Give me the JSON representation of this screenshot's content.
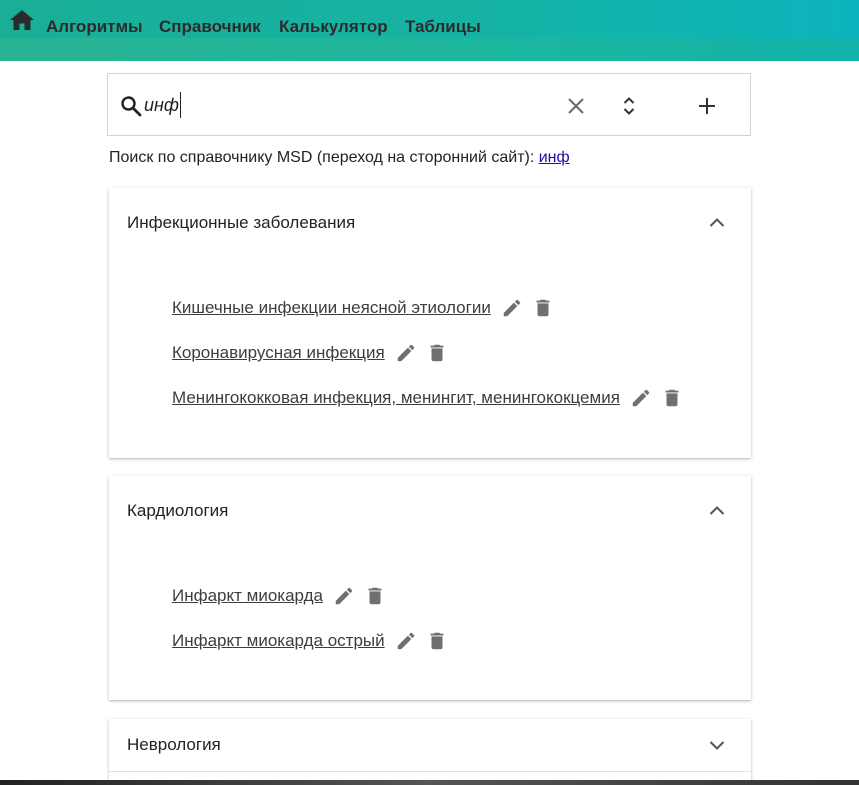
{
  "nav": {
    "home_icon": "home-icon",
    "items": [
      "Алгоритмы",
      "Справочник",
      "Калькулятор",
      "Таблицы"
    ]
  },
  "search": {
    "value": "инф",
    "icons": [
      "search-icon",
      "clear-icon",
      "expand-collapse-icon",
      "add-icon"
    ]
  },
  "msd": {
    "prefix": "Поиск по справочнику MSD (переход на сторонний сайт): ",
    "link": "инф"
  },
  "sections": [
    {
      "title": "Инфекционные заболевания",
      "expanded": true,
      "items": [
        "Кишечные инфекции неясной этиологии",
        "Коронавирусная инфекция",
        "Менингококковая инфекция, менингит, менингококцемия"
      ]
    },
    {
      "title": "Кардиология",
      "expanded": true,
      "items": [
        "Инфаркт миокарда",
        "Инфаркт миокарда острый"
      ]
    },
    {
      "title": "Неврология",
      "expanded": false,
      "items": []
    }
  ],
  "colors": {
    "topbar": "#16b3a4",
    "link": "#1a0dab",
    "icon": "#707070"
  }
}
